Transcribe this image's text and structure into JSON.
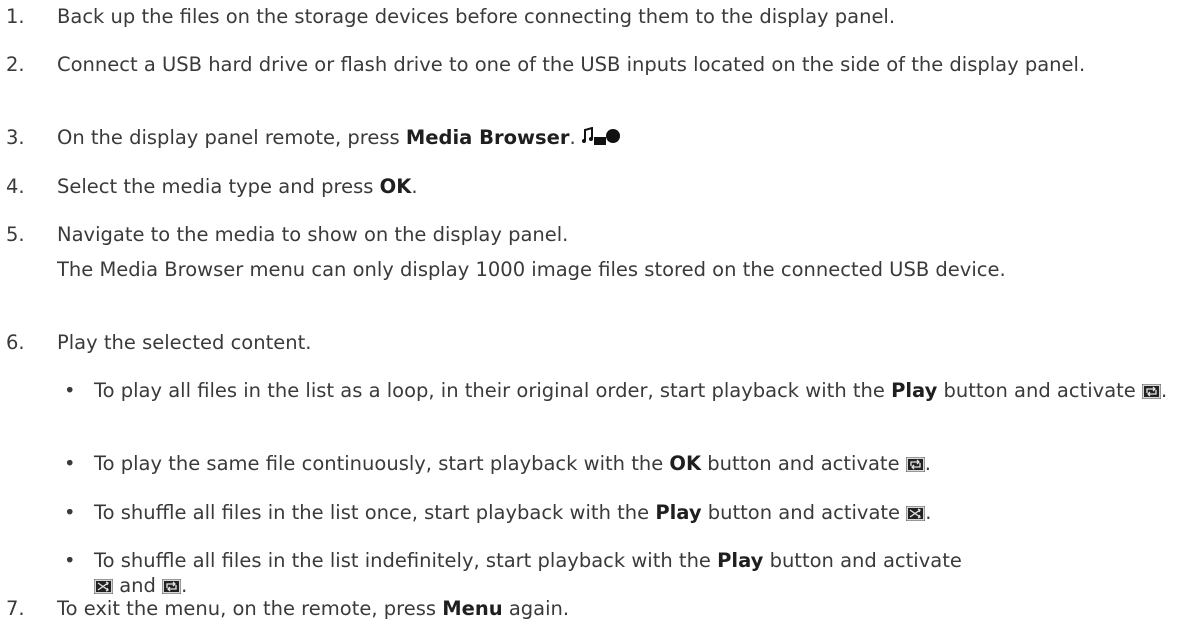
{
  "steps": [
    {
      "num": "1.",
      "text": "Back up the files on the storage devices before connecting them to the display panel."
    },
    {
      "num": "2.",
      "text": "Connect a USB hard drive or flash drive to one of the USB inputs located on the side of the display panel."
    },
    {
      "num": "3.",
      "before": "On the display panel remote, press ",
      "bold": "Media Browser",
      "after": "."
    },
    {
      "num": "4.",
      "before": "Select the media type and press ",
      "bold": "OK",
      "after": "."
    },
    {
      "num": "5.",
      "text": "Navigate to the media to show on the display panel."
    },
    {
      "num": "6.",
      "text": "Play the selected content."
    },
    {
      "num": "7.",
      "before": "To exit the menu, on the remote, press ",
      "bold": "Menu",
      "after": " again."
    }
  ],
  "note": "The Media Browser menu can only display 1000 image files stored on the connected USB device.",
  "bullet_symbol": "•",
  "bullets": [
    {
      "before": "To play all files in the list as a loop, in their original order, start playback with the ",
      "bold": "Play",
      "after": " button and activate",
      "end": "."
    },
    {
      "before": "To play the same file continuously, start playback with the ",
      "bold": "OK",
      "after": " button and activate",
      "end": "."
    },
    {
      "before": "To shuffle all files in the list once, start playback with the ",
      "bold": "Play",
      "after": " button and activate",
      "end": "."
    },
    {
      "before": "To shuffle all files in the list indefinitely, start playback with the ",
      "bold": "Play",
      "after": " button and activate",
      "middle": " and ",
      "end": "."
    }
  ],
  "icons": {
    "media_browser": "media-browser-icon",
    "repeat": "repeat-icon",
    "shuffle": "shuffle-icon"
  },
  "colors": {
    "text": "#3a3a3a",
    "bold": "#1f1f1f",
    "icon_dark": "#111111",
    "icon_light": "#d9d9d9"
  }
}
